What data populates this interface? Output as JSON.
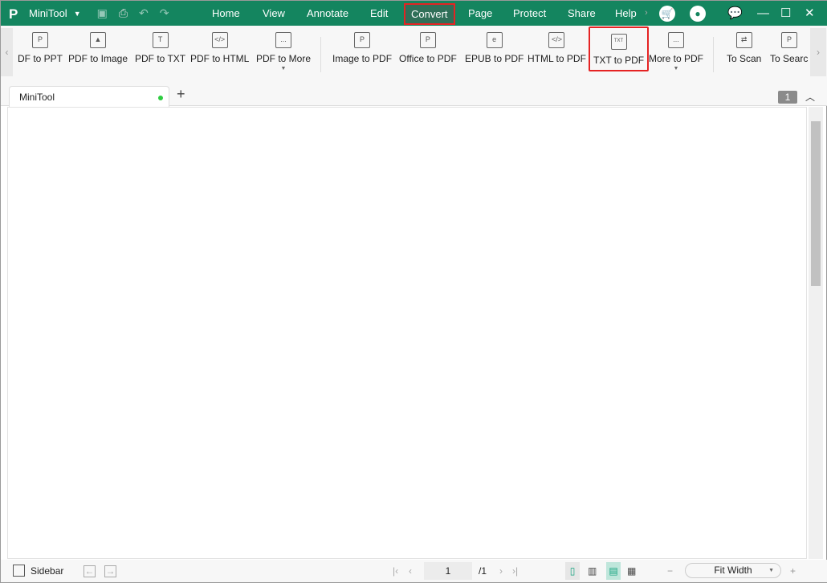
{
  "app": {
    "name": "MiniTool",
    "logo": "P"
  },
  "menu": [
    "Home",
    "View",
    "Annotate",
    "Edit",
    "Convert",
    "Page",
    "Protect",
    "Share",
    "Help"
  ],
  "active_menu": "Convert",
  "ribbon": [
    {
      "label": "DF to PPT",
      "icon": "P"
    },
    {
      "label": "PDF to Image",
      "icon": "▲"
    },
    {
      "label": "PDF to TXT",
      "icon": "T"
    },
    {
      "label": "PDF to HTML",
      "icon": "</>"
    },
    {
      "label": "PDF to More",
      "icon": "..."
    },
    {
      "label": "Image to PDF",
      "icon": "P"
    },
    {
      "label": "Office to PDF",
      "icon": "P"
    },
    {
      "label": "EPUB to PDF",
      "icon": "e"
    },
    {
      "label": "HTML to PDF",
      "icon": "</>"
    },
    {
      "label": "TXT to PDF",
      "icon": "TXT"
    },
    {
      "label": "More to PDF",
      "icon": "..."
    },
    {
      "label": "To Scan",
      "icon": "⇄"
    },
    {
      "label": "To Search",
      "icon": "P"
    }
  ],
  "highlight_color": "#e52323",
  "brand_color": "#14855f",
  "tab": {
    "label": "MiniTool",
    "page_count": "1"
  },
  "status": {
    "sidebar": "Sidebar",
    "page_input": "1",
    "page_total": "/1",
    "zoom": "Fit Width"
  }
}
